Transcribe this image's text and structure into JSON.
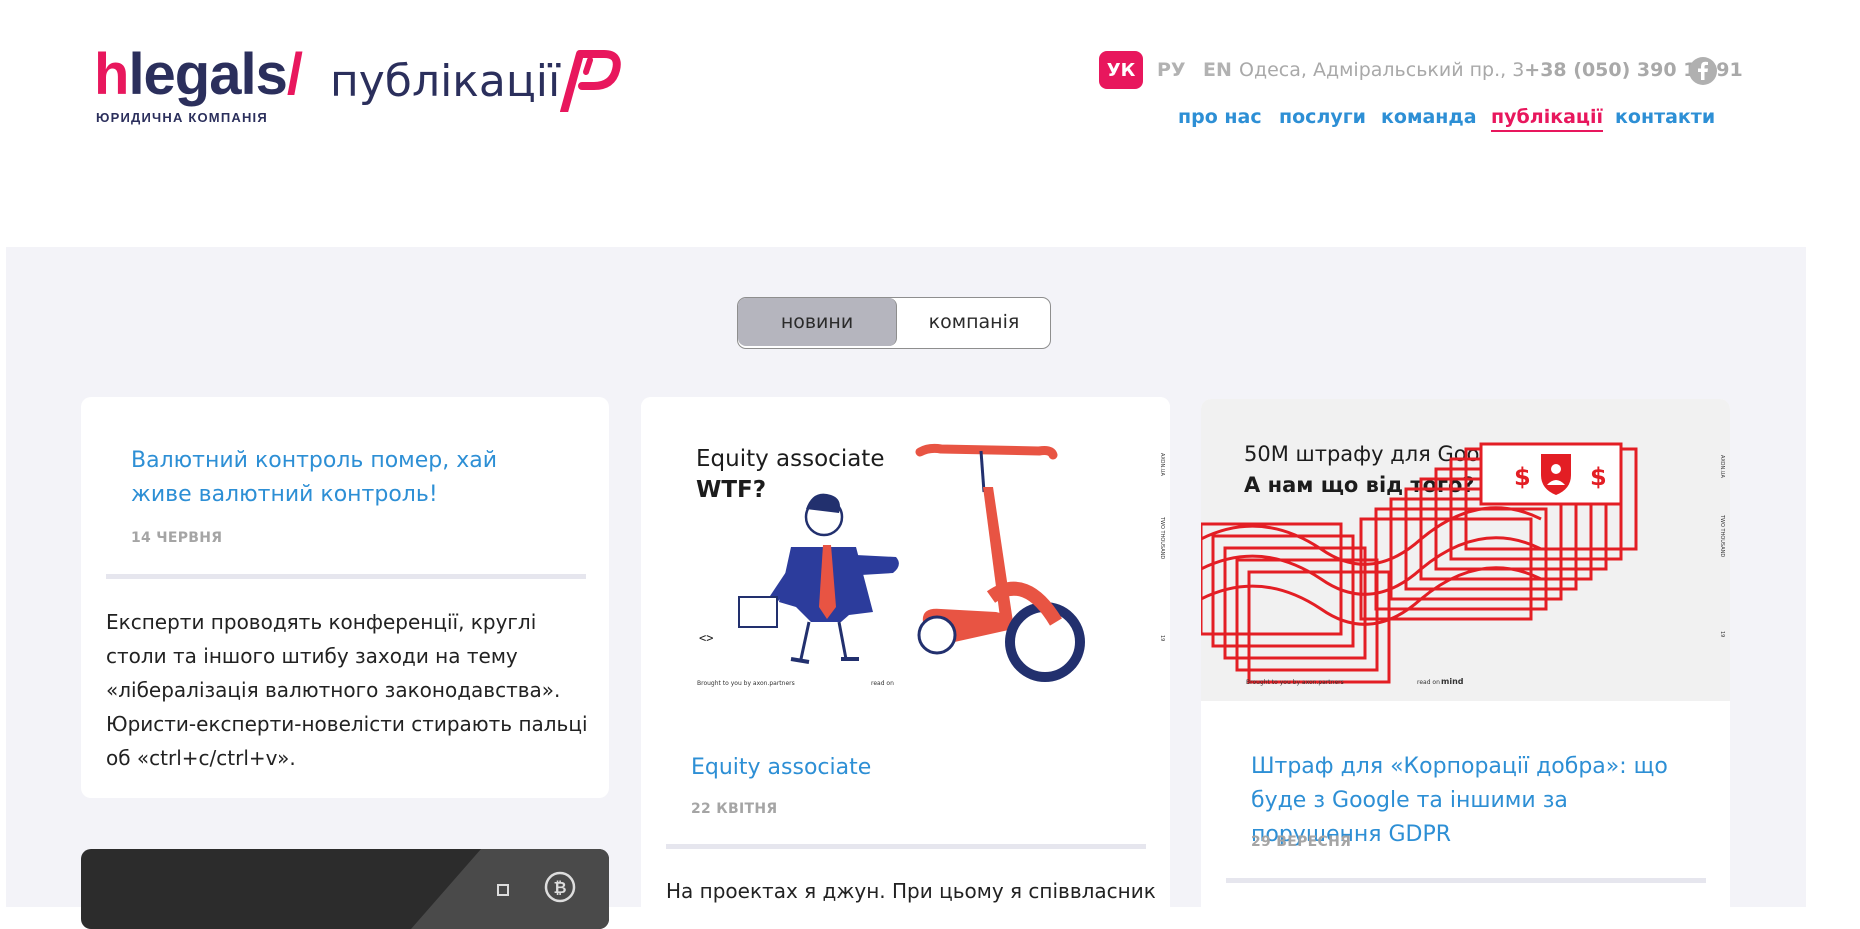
{
  "header": {
    "logo": {
      "h": "h",
      "rest": "legals",
      "slash": "/",
      "subtitle": "ЮРИДИЧНА КОМПАНІЯ"
    },
    "section_title": "публікації",
    "languages": [
      "УК",
      "РУ",
      "EN"
    ],
    "address": "Одеса, Адміральський пр., 3",
    "phone": "+38 (050) 390 15 91",
    "nav": [
      "про нас",
      "послуги",
      "команда",
      "публікації",
      "контакти"
    ],
    "active_nav": "публікації"
  },
  "tabs": {
    "news": "новини",
    "company": "компанія",
    "selected": "новини"
  },
  "posts": [
    {
      "title": "Валютний контроль помер, хай живе валютний контроль!",
      "date": "14 ЧЕРВНЯ",
      "excerpt": "Експерти проводять конференції, круглі столи та іншого штибу заходи на тему «лібералізація валютного законодавства». Юристи-експерти-новелісти стирають пальці об «ctrl+c/ctrl+v»."
    },
    {
      "title": "Equity associate",
      "date": "22 КВІТНЯ",
      "excerpt": "На проектах я джун. При цьому я співвласник",
      "image": {
        "heading_line1": "Equity associate",
        "heading_line2": "WTF?",
        "code_glyph": "<>",
        "credit": "Brought to you by axon.partners",
        "read_on": "read on",
        "side_1": "AXON.UA",
        "side_2": "TWO THOUSAND",
        "side_3": "19"
      }
    },
    {
      "title": "Штраф для «Корпорації добра»: що буде з Google та іншими за порушення GDPR",
      "date": "29 ВЕРЕСНЯ",
      "image": {
        "heading_line1": "50M штрафу для Google.",
        "heading_line2": "А нам що від того?",
        "dollar": "$",
        "credit": "Brought to you by axon.partners",
        "read_on": "read on",
        "read_on_site": "mind",
        "side_1": "AXON.UA",
        "side_2": "TWO THOUSAND",
        "side_3": "19"
      }
    }
  ],
  "colors": {
    "brand_pink": "#e8175d",
    "brand_navy": "#2b2f5c",
    "link_blue": "#2d8fd5",
    "content_bg": "#f3f3f8"
  }
}
